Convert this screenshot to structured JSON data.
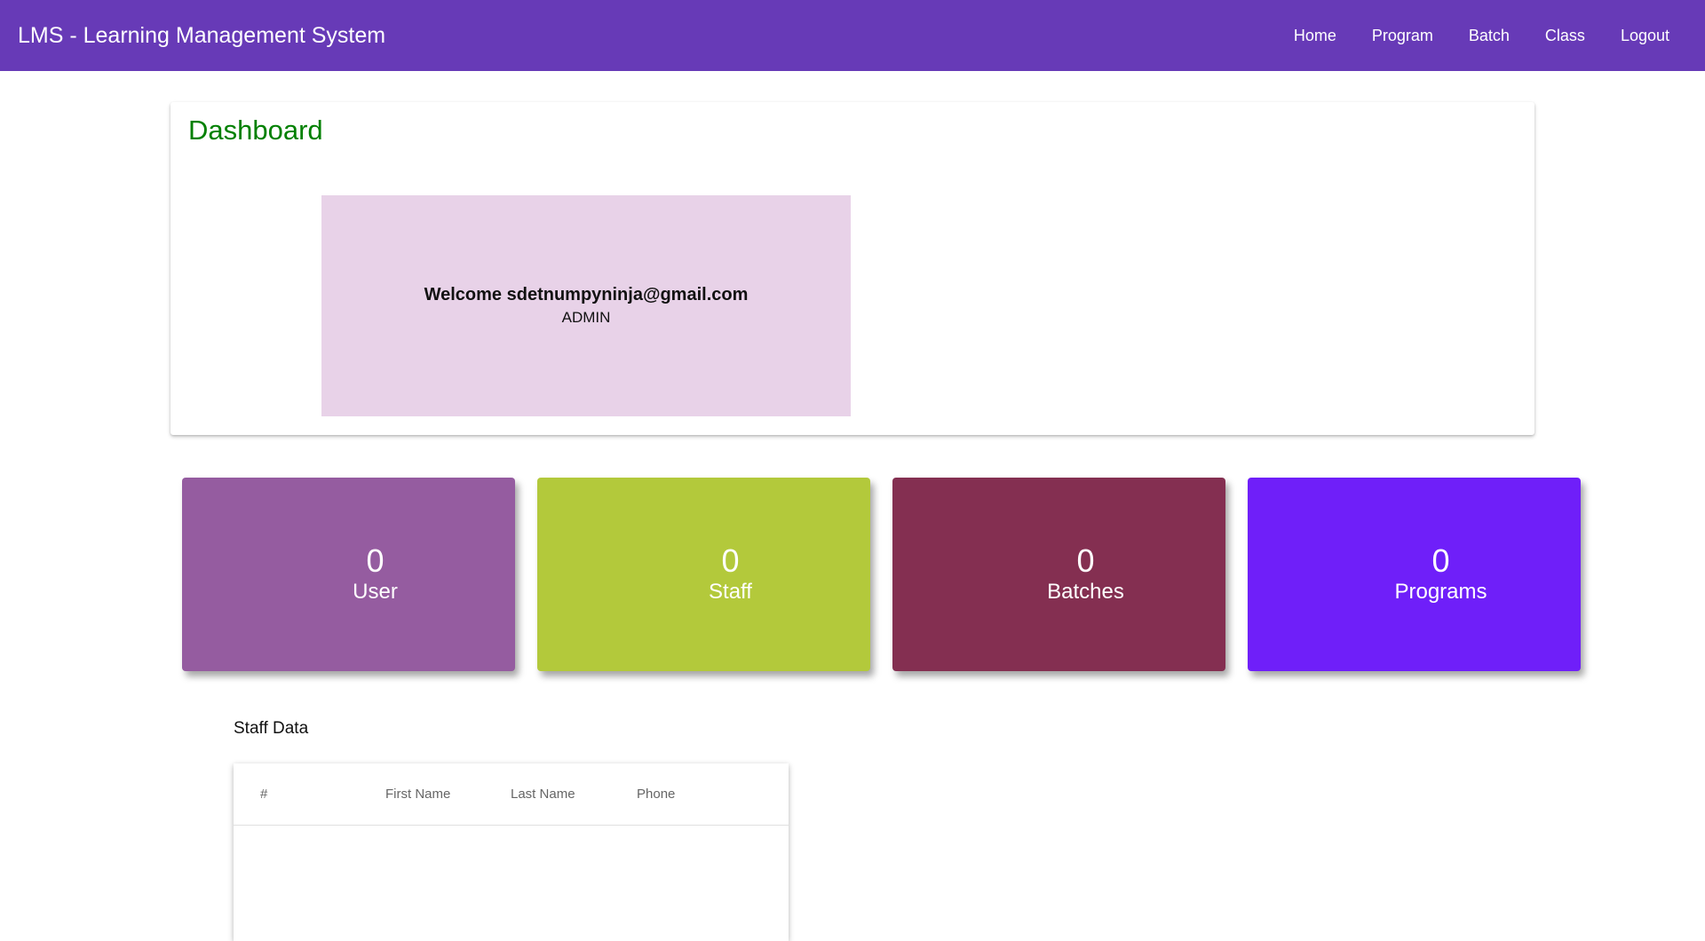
{
  "header": {
    "title": "LMS - Learning Management System",
    "nav": [
      {
        "label": "Home"
      },
      {
        "label": "Program"
      },
      {
        "label": "Batch"
      },
      {
        "label": "Class"
      },
      {
        "label": "Logout"
      }
    ],
    "background_color": "#673ab7"
  },
  "dashboard": {
    "title": "Dashboard",
    "welcome": "Welcome sdetnumpyninja@gmail.com",
    "role": "ADMIN"
  },
  "stats": [
    {
      "count": "0",
      "label": "User",
      "color": "#955ca0"
    },
    {
      "count": "0",
      "label": "Staff",
      "color": "#b3c93b"
    },
    {
      "count": "0",
      "label": "Batches",
      "color": "#842f51"
    },
    {
      "count": "0",
      "label": "Programs",
      "color": "#6f1ff9"
    }
  ],
  "staff_table": {
    "heading": "Staff Data",
    "columns": [
      "#",
      "First Name",
      "Last Name",
      "Phone"
    ],
    "rows": []
  }
}
